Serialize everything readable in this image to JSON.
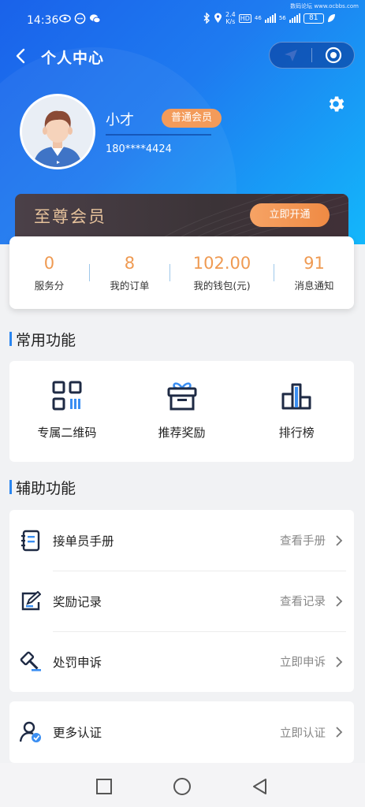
{
  "status_bar": {
    "time": "14:36",
    "speed_value": "2.4",
    "speed_unit": "K/s",
    "hd": "HD",
    "net_a": "46",
    "net_b": "56",
    "battery": "81",
    "watermark": "数码论坛 www.ocbbs.com"
  },
  "nav": {
    "title": "个人中心",
    "back_icon": "chevron-left-icon",
    "capsule_icons": [
      "paper-plane-icon",
      "target-circle-icon"
    ]
  },
  "profile": {
    "name": "小才",
    "member_level": "普通会员",
    "phone": "180****4424"
  },
  "vip": {
    "title": "至尊会员",
    "open_button": "立即开通"
  },
  "stats": [
    {
      "value": "0",
      "label": "服务分"
    },
    {
      "value": "8",
      "label": "我的订单"
    },
    {
      "value": "102.00",
      "label": "我的钱包(元)"
    },
    {
      "value": "91",
      "label": "消息通知"
    }
  ],
  "common_functions": {
    "title": "常用功能",
    "items": [
      {
        "label": "专属二维码",
        "icon": "qr-code-icon"
      },
      {
        "label": "推荐奖励",
        "icon": "gift-icon"
      },
      {
        "label": "排行榜",
        "icon": "ranking-icon"
      }
    ]
  },
  "aux_functions": {
    "title": "辅助功能",
    "items": [
      {
        "label": "接单员手册",
        "action": "查看手册",
        "icon": "notebook-icon"
      },
      {
        "label": "奖励记录",
        "action": "查看记录",
        "icon": "edit-record-icon"
      },
      {
        "label": "处罚申诉",
        "action": "立即申诉",
        "icon": "gavel-icon"
      }
    ],
    "extra": {
      "label": "更多认证",
      "action": "立即认证",
      "icon": "user-verified-icon"
    }
  },
  "colors": {
    "header_gradient": [
      "#1a62ea",
      "#13b7fb"
    ],
    "accent_orange": "#ef9a52",
    "vip_gold": "#e5c19b",
    "section_bar": "#2a86f0"
  }
}
